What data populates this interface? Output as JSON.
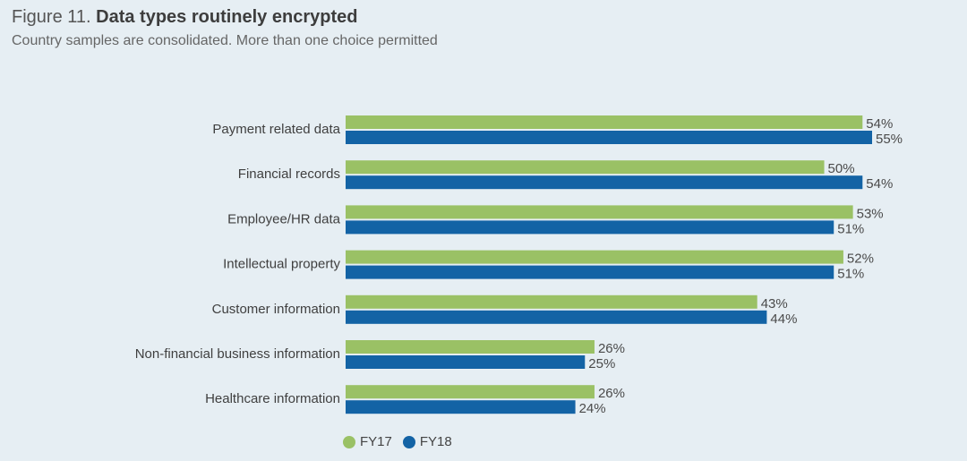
{
  "title_prefix": "Figure 11.",
  "title_main": "Data types routinely encrypted",
  "subtitle": "Country samples are consolidated. More than one choice permitted",
  "colors": {
    "fy17": "#9ac165",
    "fy18": "#1363a5"
  },
  "chart_data": {
    "type": "bar",
    "orientation": "horizontal",
    "categories": [
      "Payment related data",
      "Financial records",
      "Employee/HR data",
      "Intellectual property",
      "Customer information",
      "Non-financial business information",
      "Healthcare information"
    ],
    "series": [
      {
        "name": "FY17",
        "values": [
          54,
          50,
          53,
          52,
          43,
          26,
          26
        ],
        "labels": [
          "54%",
          "50%",
          "53%",
          "52%",
          "43%",
          "26%",
          "26%"
        ]
      },
      {
        "name": "FY18",
        "values": [
          55,
          54,
          51,
          51,
          44,
          25,
          24
        ],
        "labels": [
          "55%",
          "54%",
          "51%",
          "51%",
          "44%",
          "25%",
          "24%"
        ]
      }
    ],
    "xlim": [
      0,
      55
    ],
    "grid": false,
    "legend": "bottom"
  }
}
